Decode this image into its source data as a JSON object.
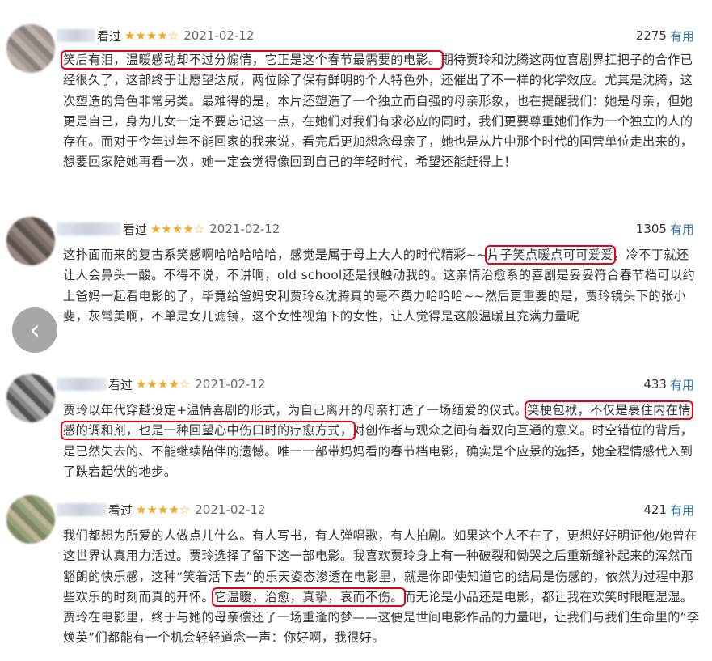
{
  "reviews": [
    {
      "status": "看过",
      "stars": "★★★★☆",
      "date": "2021-02-12",
      "votes": "2275",
      "useful_label": "有用",
      "text_highlight": "笑后有泪，温暖感动却不过分煽情，它正是这个春节最需要的电影。",
      "text_after": "期待贾玲和沈腾这两位喜剧界扛把子的合作已经很久了，这部终于让愿望达成，两位除了保有鲜明的个人特色外，还催出了不一样的化学效应。尤其是沈腾，这次塑造的角色非常另类。最难得的是，本片还塑造了一个独立而自强的母亲形象，也在提醒我们：她是母亲，但她更是自己，身为儿女一定不要忘记这一点，在她们对我们有求必应的同时，我们更要尊重她们作为一个独立的人的存在。而对于今年过年不能回家的我来说，看完后更加想念母亲了，她也是从片中那个时代的国营单位走出来的，想要回家陪她再看一次，她一定会觉得像回到自己的年轻时代，希望还能赶得上！"
    },
    {
      "status": "看过",
      "stars": "★★★★☆",
      "date": "2021-02-12",
      "votes": "1305",
      "useful_label": "有用",
      "text_before": "这扑面而来的复古系笑感啊哈哈哈哈哈，感觉是属于母上大人的时代精彩~~",
      "text_highlight": "片子笑点暖点可可爱爱",
      "text_after": "，冷不丁就还让人会鼻头一酸。不得不说，不讲啊，old school还是很触动我的。这亲情治愈系的喜剧是妥妥符合春节档可以约上爸妈一起看电影的了，毕竟给爸妈安利贾玲&沈腾真的毫不费力哈哈哈~~然后更重要的是，贾玲镜头下的张小斐，灰常美啊，不单是女儿滤镜，这个女性视角下的女性，让人觉得是这般温暖且充满力量呢"
    },
    {
      "status": "看过",
      "stars": "★★★★☆",
      "date": "2021-02-12",
      "votes": "433",
      "useful_label": "有用",
      "text_before": "贾玲以年代穿越设定+温情喜剧的形式，为自己离开的母亲打造了一场缅爱的仪式。",
      "text_highlight": "笑梗包袱，不仅是裹住内在情感的调和剂，也是一种回望心中伤口时的疗愈方式，",
      "text_after": "对创作者与观众之间有着双向互通的意义。时空错位的背后，是已然失去的、不能继续陪伴的遗憾。唯一一部带妈妈看的春节档电影，确实是个应景的选择，她全程情感代入到了跌宕起伏的地步。"
    },
    {
      "status": "看过",
      "stars": "★★★★☆",
      "date": "2021-02-12",
      "votes": "421",
      "useful_label": "有用",
      "text_before": "我们都想为所爱的人做点儿什么。有人写书，有人弹唱歌，有人拍剧。如果这个人不在了，更想好好明证他/她曾在这世界认真用力活过。贾玲选择了留下这一部电影。我喜欢贾玲身上有一种破裂和恸哭之后重新缝补起来的浑然而豁朗的快乐感，这种“笑着活下去”的乐天姿态渗透在电影里，就是你即使知道它的结局是伤感的，依然为过程中那些欢乐的时刻而真的开怀。",
      "text_highlight": "它温暖，治愈，真挚，哀而不伤。",
      "text_after": "而无论是小品还是电影，都让我在欢笑时眼眶湿湿。贾玲在电影里，终于与她的母亲偿还了一场重逢的梦——这便是世间电影作品的力量吧，让我们与我们生命里的“李焕英”们都能有一个机会轻轻道念一声：你好啊，我很好。"
    }
  ],
  "nav": {
    "back_icon": "chevron-left-icon",
    "back_glyph": "‹"
  }
}
